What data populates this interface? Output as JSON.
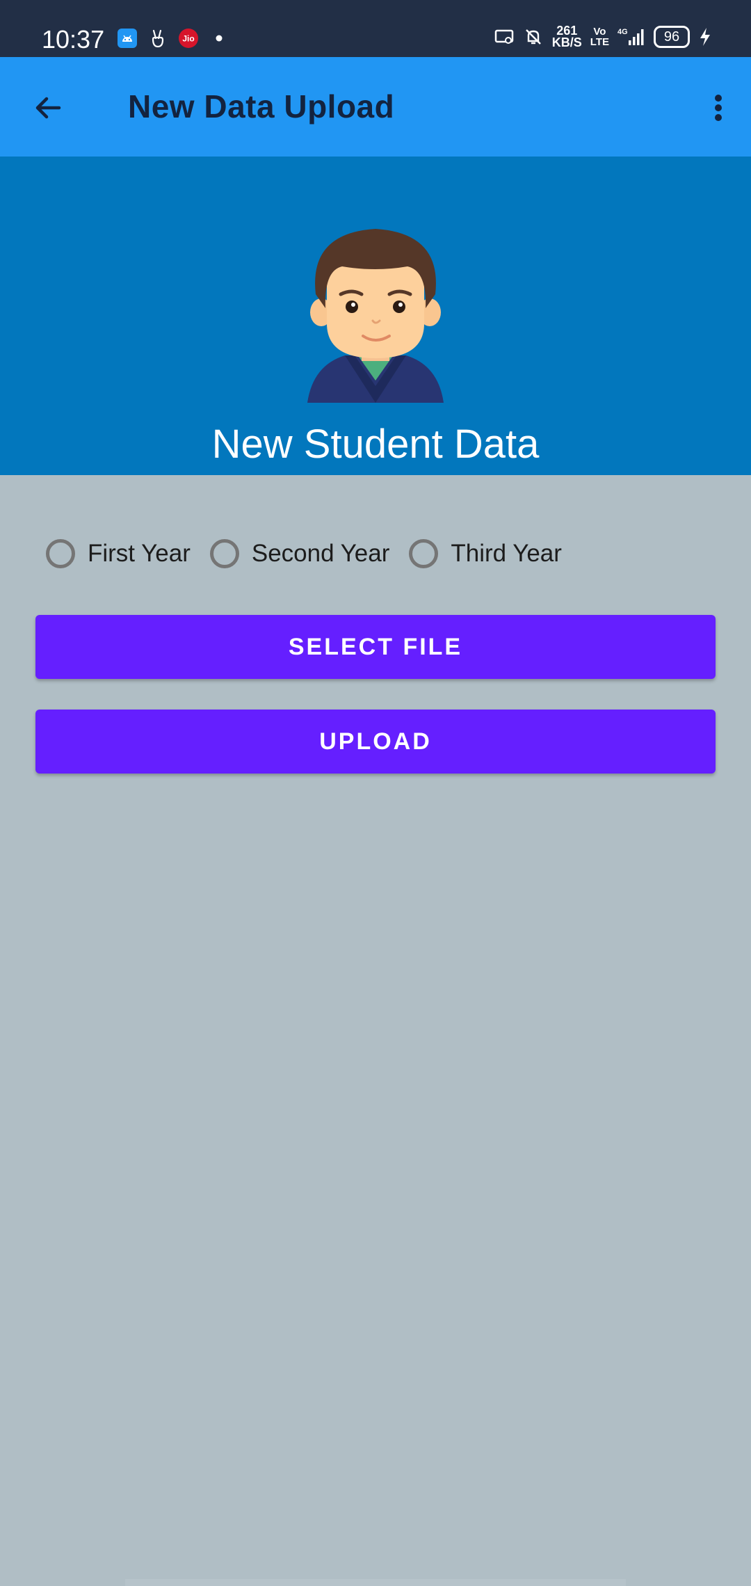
{
  "status_bar": {
    "time": "10:37",
    "left_icons": [
      "android-icon",
      "peace-hand-icon",
      "jio-icon",
      "dot-icon"
    ],
    "jio_label": "Jio",
    "net_speed_value": "261",
    "net_speed_unit": "KB/S",
    "volte_top": "Vo",
    "volte_bottom": "LTE",
    "network_label": "4G",
    "battery_level": "96",
    "right_icons": [
      "cast-icon",
      "bell-off-icon",
      "net-speed",
      "volte-icon",
      "signal-icon",
      "battery-icon",
      "charging-icon"
    ]
  },
  "app_bar": {
    "title": "New Data Upload",
    "back_icon": "arrow-back-icon",
    "menu_icon": "more-vert-icon"
  },
  "header": {
    "title": "New Student Data",
    "avatar": "student-avatar"
  },
  "radios": [
    {
      "label": "First Year",
      "selected": false
    },
    {
      "label": "Second Year",
      "selected": false
    },
    {
      "label": "Third Year",
      "selected": false
    }
  ],
  "buttons": {
    "select_file": "SELECT FILE",
    "upload": "UPLOAD"
  },
  "colors": {
    "status_bar": "#222f46",
    "app_bar": "#2196f3",
    "header_panel": "#0277bd",
    "background": "#b0bec5",
    "button": "#651fff"
  }
}
